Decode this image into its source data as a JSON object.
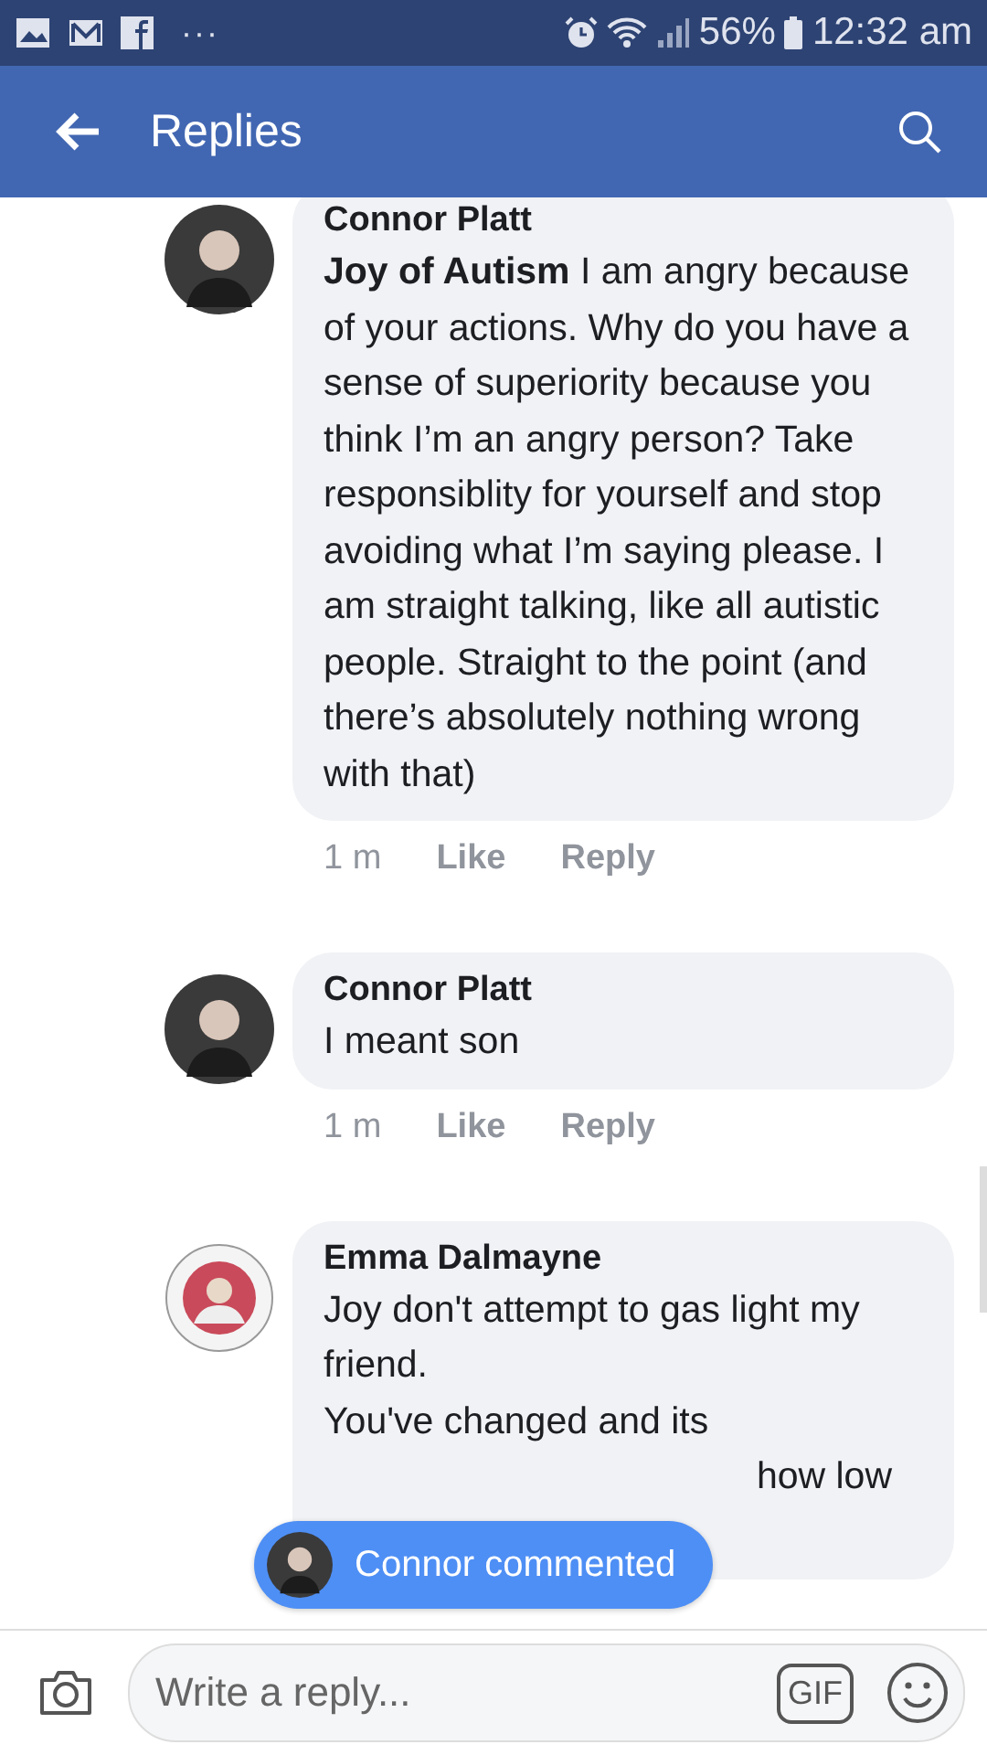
{
  "status_bar": {
    "more": "···",
    "battery": "56%",
    "time": "12:32 am"
  },
  "header": {
    "title": "Replies"
  },
  "comments": [
    {
      "author": "Connor Platt",
      "text": "**Joy of Autism**  I am angry because of your actions. Why do you have a sense of superiority because you think I’m an angry person? Take responsiblity for yourself and stop avoiding what I’m saying please. I am straight talking, like all autistic people. Straight to the point (and there’s absolutely nothing wrong with that)",
      "time": "1 m",
      "actions": [
        "Like",
        "Reply"
      ],
      "kind": "dark"
    },
    {
      "author": "Connor Platt",
      "text": "I meant son",
      "time": "1 m",
      "actions": [
        "Like",
        "Reply"
      ],
      "kind": "dark"
    },
    {
      "author": "Emma Dalmayne",
      "text": "Joy don't attempt to gas light my friend.\nYou've changed and its",
      "tail": "how low",
      "kind": "badge"
    }
  ],
  "toast": {
    "label": "Connor commented"
  },
  "composer": {
    "placeholder": "Write a reply...",
    "gif": "GIF"
  }
}
